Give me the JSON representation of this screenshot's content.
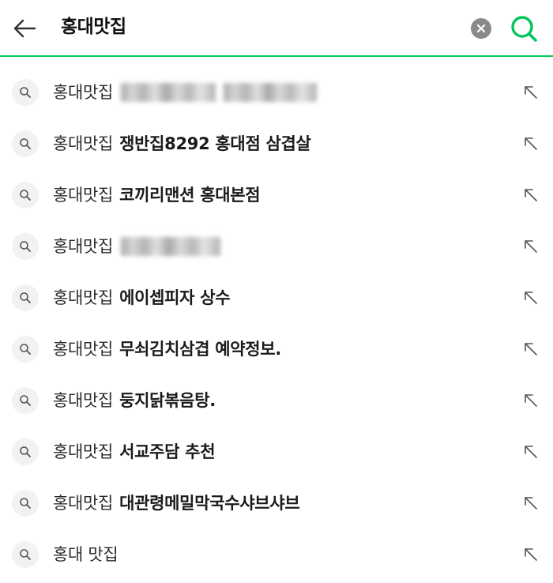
{
  "search": {
    "query": "홍대맛집",
    "accent_color": "#03c75a"
  },
  "suggestions": [
    {
      "keyword": "홍대맛집",
      "rest": "",
      "redacted": true
    },
    {
      "keyword": "홍대맛집",
      "rest": "쟁반집8292 홍대점 삼겹살",
      "redacted": false
    },
    {
      "keyword": "홍대맛집",
      "rest": "코끼리맨션 홍대본점",
      "redacted": false
    },
    {
      "keyword": "홍대맛집",
      "rest": "",
      "redacted": true
    },
    {
      "keyword": "홍대맛집",
      "rest": "에이셉피자 상수",
      "redacted": false
    },
    {
      "keyword": "홍대맛집",
      "rest": "무쇠김치삼겹 예약정보.",
      "redacted": false
    },
    {
      "keyword": "홍대맛집",
      "rest": "둥지닭볶음탕.",
      "redacted": false
    },
    {
      "keyword": "홍대맛집",
      "rest": "서교주담 추천",
      "redacted": false
    },
    {
      "keyword": "홍대맛집",
      "rest": "대관령메밀막국수샤브샤브",
      "redacted": false
    },
    {
      "keyword": "홍대 맛집",
      "rest": "",
      "redacted": false
    }
  ],
  "icons": {
    "back": "arrow-left-icon",
    "clear": "close-circle-icon",
    "search": "search-icon",
    "item": "search-icon",
    "fill": "arrow-up-left-icon"
  }
}
